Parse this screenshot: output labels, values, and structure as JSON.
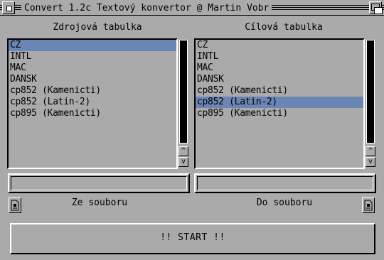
{
  "window": {
    "title": "Convert 1.2c  Textový konvertor @ Martin Vobr"
  },
  "source": {
    "heading": "Zdrojová tabulka",
    "items": [
      "CZ",
      "INTL",
      "MAC",
      "DANSK",
      "cp852 (Kamenicti)",
      "cp852 (Latin-2)",
      "cp895 (Kamenicti)"
    ],
    "selected_index": 0,
    "path_value": "",
    "file_button_label": "Ze souboru"
  },
  "target": {
    "heading": "Cílová tabulka",
    "items": [
      "CZ",
      "INTL",
      "MAC",
      "DANSK",
      "cp852 (Kamenicti)",
      "cp852 (Latin-2)",
      "cp895 (Kamenicti)"
    ],
    "selected_index": 5,
    "path_value": "",
    "file_button_label": "Do souboru"
  },
  "scroll_arrows": {
    "up": "^",
    "down": "v"
  },
  "start_button": {
    "label": "!! START !!"
  },
  "colors": {
    "background": "#aaaaaa",
    "selection": "#6b85b5",
    "shine": "#ffffff",
    "shadow": "#000000"
  },
  "icons": {
    "close": "close-gadget-icon",
    "depth": "depth-gadget-icon",
    "file": "file-requester-icon"
  }
}
